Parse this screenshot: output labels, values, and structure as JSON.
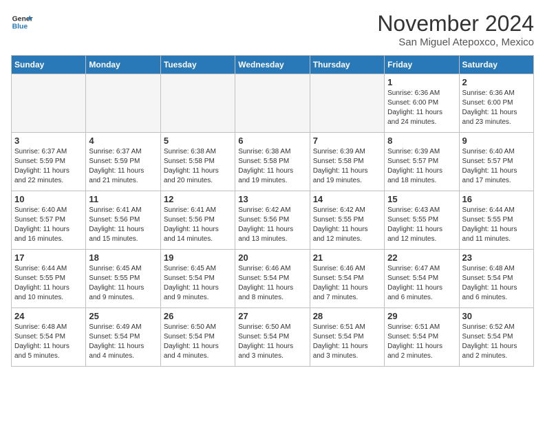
{
  "header": {
    "logo_line1": "General",
    "logo_line2": "Blue",
    "month": "November 2024",
    "location": "San Miguel Atepoxco, Mexico"
  },
  "weekdays": [
    "Sunday",
    "Monday",
    "Tuesday",
    "Wednesday",
    "Thursday",
    "Friday",
    "Saturday"
  ],
  "weeks": [
    [
      {
        "day": "",
        "info": ""
      },
      {
        "day": "",
        "info": ""
      },
      {
        "day": "",
        "info": ""
      },
      {
        "day": "",
        "info": ""
      },
      {
        "day": "",
        "info": ""
      },
      {
        "day": "1",
        "info": "Sunrise: 6:36 AM\nSunset: 6:00 PM\nDaylight: 11 hours\nand 24 minutes."
      },
      {
        "day": "2",
        "info": "Sunrise: 6:36 AM\nSunset: 6:00 PM\nDaylight: 11 hours\nand 23 minutes."
      }
    ],
    [
      {
        "day": "3",
        "info": "Sunrise: 6:37 AM\nSunset: 5:59 PM\nDaylight: 11 hours\nand 22 minutes."
      },
      {
        "day": "4",
        "info": "Sunrise: 6:37 AM\nSunset: 5:59 PM\nDaylight: 11 hours\nand 21 minutes."
      },
      {
        "day": "5",
        "info": "Sunrise: 6:38 AM\nSunset: 5:58 PM\nDaylight: 11 hours\nand 20 minutes."
      },
      {
        "day": "6",
        "info": "Sunrise: 6:38 AM\nSunset: 5:58 PM\nDaylight: 11 hours\nand 19 minutes."
      },
      {
        "day": "7",
        "info": "Sunrise: 6:39 AM\nSunset: 5:58 PM\nDaylight: 11 hours\nand 19 minutes."
      },
      {
        "day": "8",
        "info": "Sunrise: 6:39 AM\nSunset: 5:57 PM\nDaylight: 11 hours\nand 18 minutes."
      },
      {
        "day": "9",
        "info": "Sunrise: 6:40 AM\nSunset: 5:57 PM\nDaylight: 11 hours\nand 17 minutes."
      }
    ],
    [
      {
        "day": "10",
        "info": "Sunrise: 6:40 AM\nSunset: 5:57 PM\nDaylight: 11 hours\nand 16 minutes."
      },
      {
        "day": "11",
        "info": "Sunrise: 6:41 AM\nSunset: 5:56 PM\nDaylight: 11 hours\nand 15 minutes."
      },
      {
        "day": "12",
        "info": "Sunrise: 6:41 AM\nSunset: 5:56 PM\nDaylight: 11 hours\nand 14 minutes."
      },
      {
        "day": "13",
        "info": "Sunrise: 6:42 AM\nSunset: 5:56 PM\nDaylight: 11 hours\nand 13 minutes."
      },
      {
        "day": "14",
        "info": "Sunrise: 6:42 AM\nSunset: 5:55 PM\nDaylight: 11 hours\nand 12 minutes."
      },
      {
        "day": "15",
        "info": "Sunrise: 6:43 AM\nSunset: 5:55 PM\nDaylight: 11 hours\nand 12 minutes."
      },
      {
        "day": "16",
        "info": "Sunrise: 6:44 AM\nSunset: 5:55 PM\nDaylight: 11 hours\nand 11 minutes."
      }
    ],
    [
      {
        "day": "17",
        "info": "Sunrise: 6:44 AM\nSunset: 5:55 PM\nDaylight: 11 hours\nand 10 minutes."
      },
      {
        "day": "18",
        "info": "Sunrise: 6:45 AM\nSunset: 5:55 PM\nDaylight: 11 hours\nand 9 minutes."
      },
      {
        "day": "19",
        "info": "Sunrise: 6:45 AM\nSunset: 5:54 PM\nDaylight: 11 hours\nand 9 minutes."
      },
      {
        "day": "20",
        "info": "Sunrise: 6:46 AM\nSunset: 5:54 PM\nDaylight: 11 hours\nand 8 minutes."
      },
      {
        "day": "21",
        "info": "Sunrise: 6:46 AM\nSunset: 5:54 PM\nDaylight: 11 hours\nand 7 minutes."
      },
      {
        "day": "22",
        "info": "Sunrise: 6:47 AM\nSunset: 5:54 PM\nDaylight: 11 hours\nand 6 minutes."
      },
      {
        "day": "23",
        "info": "Sunrise: 6:48 AM\nSunset: 5:54 PM\nDaylight: 11 hours\nand 6 minutes."
      }
    ],
    [
      {
        "day": "24",
        "info": "Sunrise: 6:48 AM\nSunset: 5:54 PM\nDaylight: 11 hours\nand 5 minutes."
      },
      {
        "day": "25",
        "info": "Sunrise: 6:49 AM\nSunset: 5:54 PM\nDaylight: 11 hours\nand 4 minutes."
      },
      {
        "day": "26",
        "info": "Sunrise: 6:50 AM\nSunset: 5:54 PM\nDaylight: 11 hours\nand 4 minutes."
      },
      {
        "day": "27",
        "info": "Sunrise: 6:50 AM\nSunset: 5:54 PM\nDaylight: 11 hours\nand 3 minutes."
      },
      {
        "day": "28",
        "info": "Sunrise: 6:51 AM\nSunset: 5:54 PM\nDaylight: 11 hours\nand 3 minutes."
      },
      {
        "day": "29",
        "info": "Sunrise: 6:51 AM\nSunset: 5:54 PM\nDaylight: 11 hours\nand 2 minutes."
      },
      {
        "day": "30",
        "info": "Sunrise: 6:52 AM\nSunset: 5:54 PM\nDaylight: 11 hours\nand 2 minutes."
      }
    ]
  ]
}
